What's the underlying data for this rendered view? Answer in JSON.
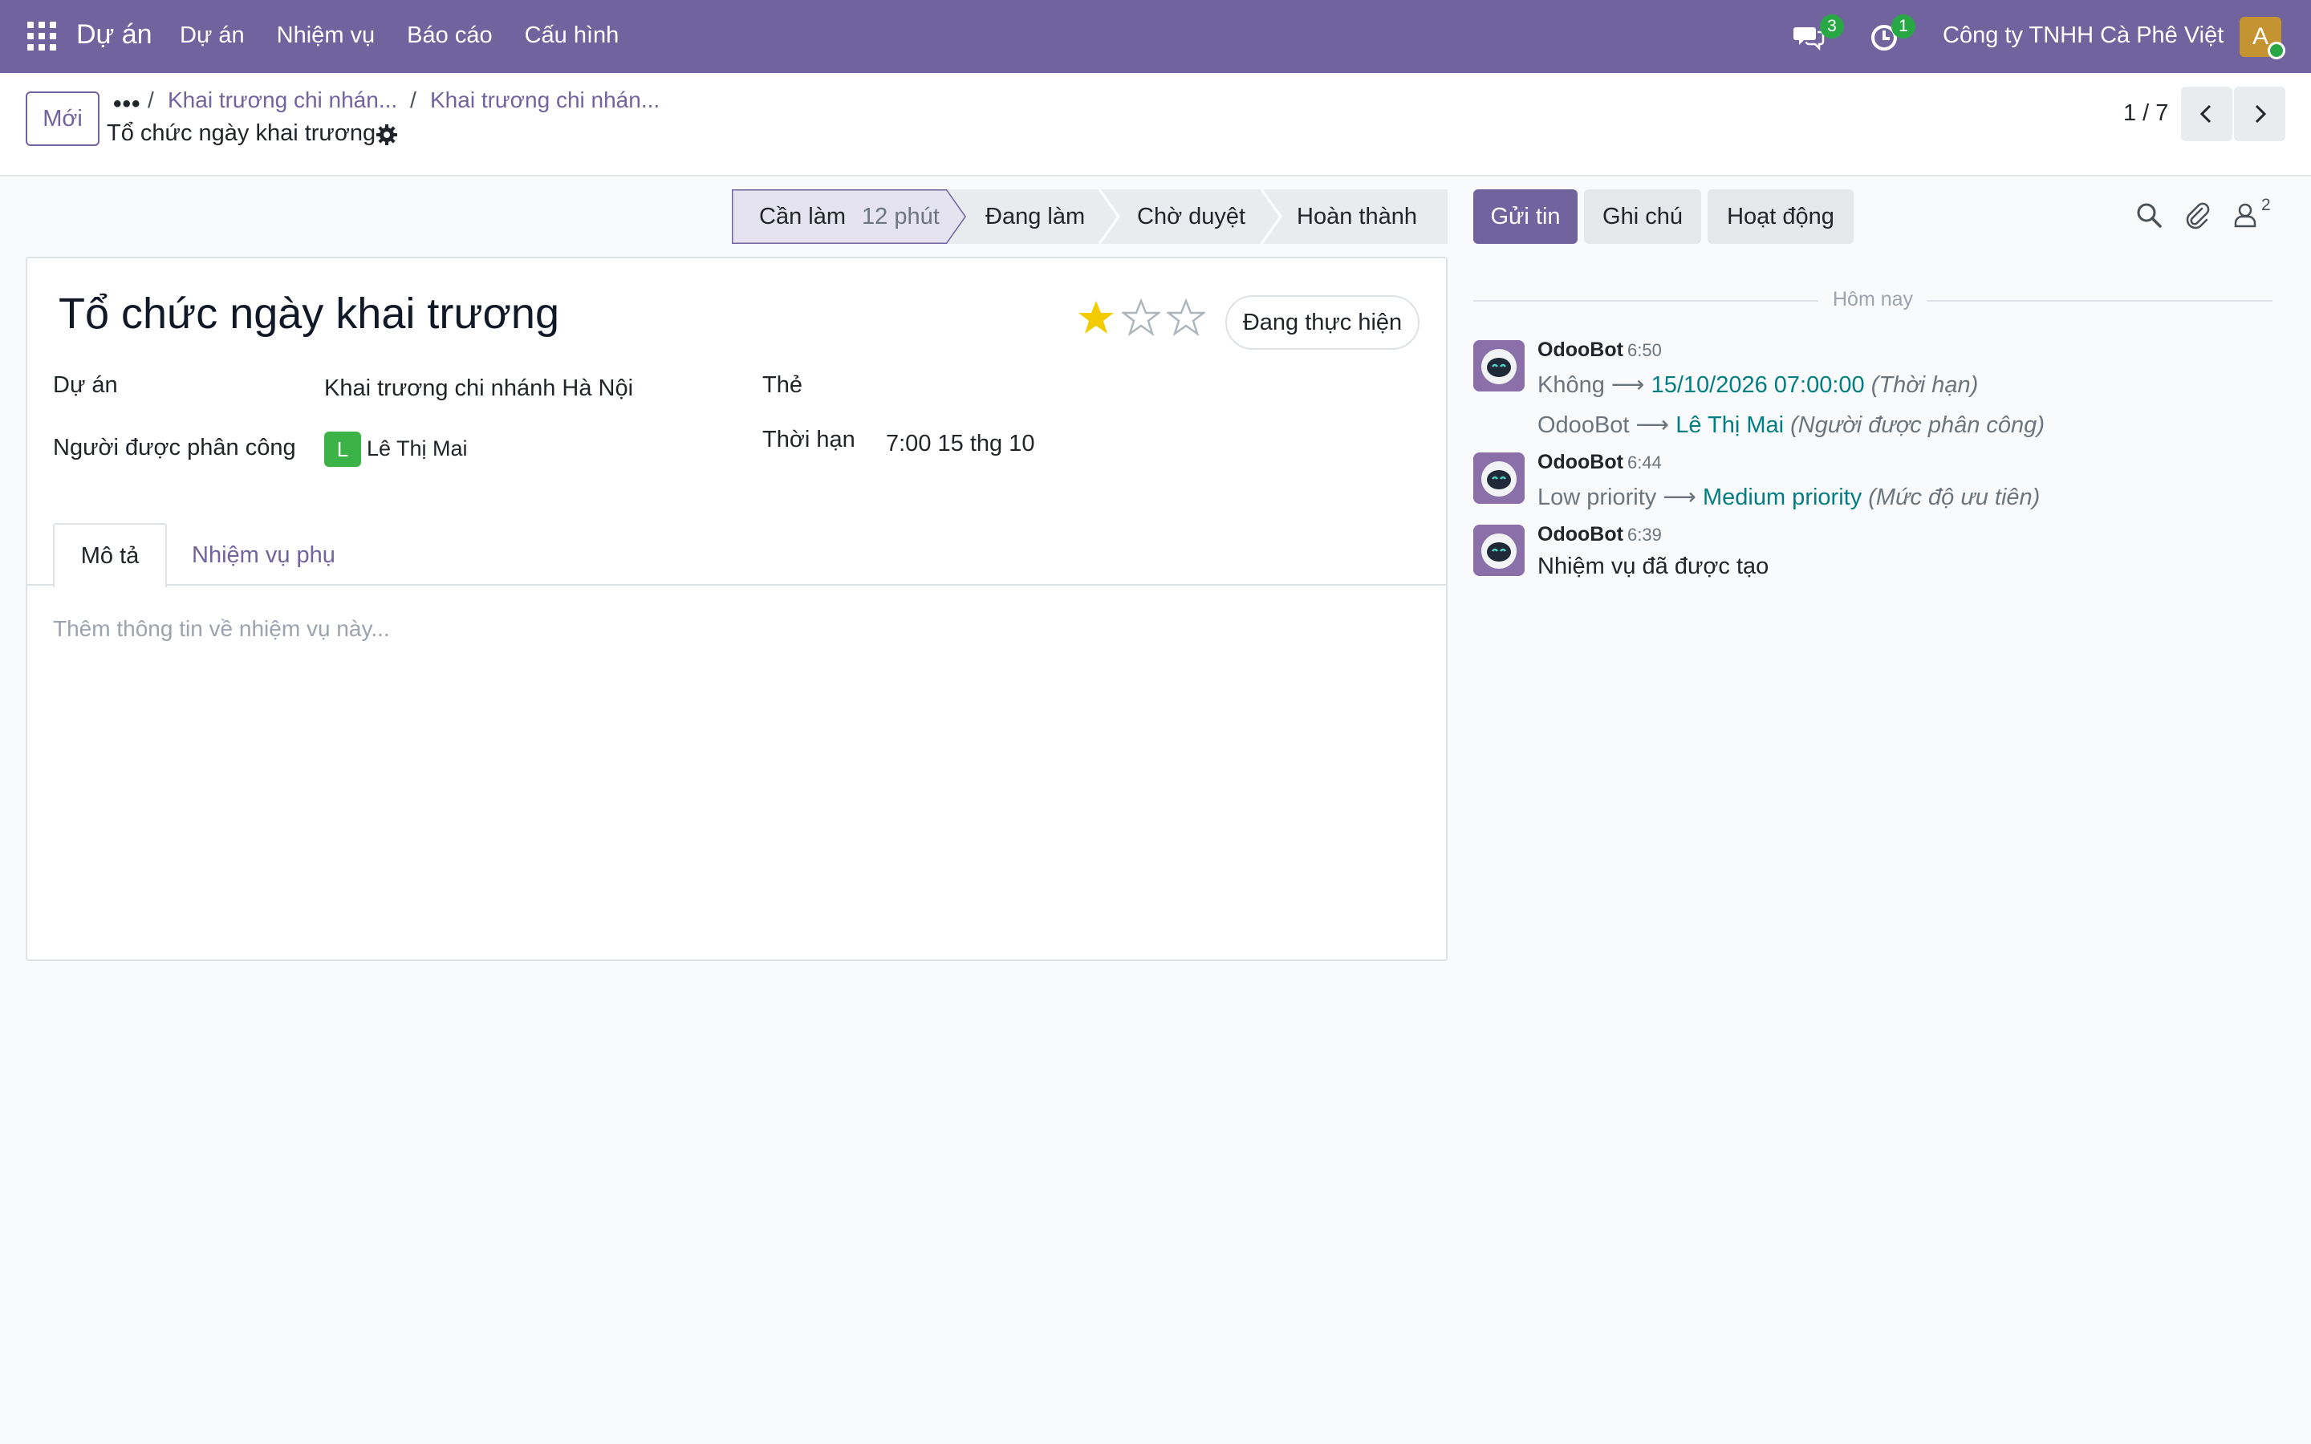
{
  "navbar": {
    "app_title": "Dự án",
    "menu": [
      "Dự án",
      "Nhiệm vụ",
      "Báo cáo",
      "Cấu hình"
    ],
    "messages_badge": "3",
    "activities_badge": "1",
    "company": "Công ty TNHH Cà Phê Việt",
    "user_initial": "A"
  },
  "control_panel": {
    "new_button": "Mới",
    "breadcrumb_more": "•••",
    "breadcrumbs": [
      "Khai trương chi nhán...",
      "Khai trương chi nhán..."
    ],
    "separator": "/",
    "current": "Tổ chức ngày khai trương",
    "pager": "1 / 7"
  },
  "status_bar": {
    "stages": [
      {
        "label": "Cần làm",
        "duration": "12 phút",
        "active": true
      },
      {
        "label": "Đang làm"
      },
      {
        "label": "Chờ duyệt"
      },
      {
        "label": "Hoàn thành"
      }
    ]
  },
  "form": {
    "title": "Tổ chức ngày khai trương",
    "priority": {
      "value": 1,
      "max": 3
    },
    "state_button": "Đang thực hiện",
    "project_label": "Dự án",
    "project_value": "Khai trương chi nhánh Hà Nội",
    "assignee_label": "Người được phân công",
    "assignee_initial": "L",
    "assignee_value": "Lê Thị Mai",
    "tags_label": "Thẻ",
    "deadline_label": "Thời hạn",
    "deadline_value": "7:00 15 thg 10",
    "tabs": [
      "Mô tả",
      "Nhiệm vụ phụ"
    ],
    "description_placeholder": "Thêm thông tin về nhiệm vụ này..."
  },
  "chatter": {
    "send_message": "Gửi tin",
    "log_note": "Ghi chú",
    "activities": "Hoạt động",
    "followers_count": "2",
    "date_separator": "Hôm nay",
    "arrow": "⟶",
    "messages": [
      {
        "author": "OdooBot",
        "time": "6:50",
        "tracking": [
          {
            "old": "Không",
            "new": "15/10/2026 07:00:00",
            "field": "(Thời hạn)"
          },
          {
            "old": "OdooBot",
            "new": "Lê Thị Mai",
            "field": "(Người được phân công)"
          }
        ]
      },
      {
        "author": "OdooBot",
        "time": "6:44",
        "tracking": [
          {
            "old": "Low priority",
            "new": "Medium priority",
            "field": "(Mức độ ưu tiên)"
          }
        ]
      },
      {
        "author": "OdooBot",
        "time": "6:39",
        "body": "Nhiệm vụ đã được tạo"
      }
    ]
  },
  "colors": {
    "brand": "#71639e",
    "tracking_value": "#017e84",
    "star": "#f3cc00",
    "success": "#28a745"
  }
}
